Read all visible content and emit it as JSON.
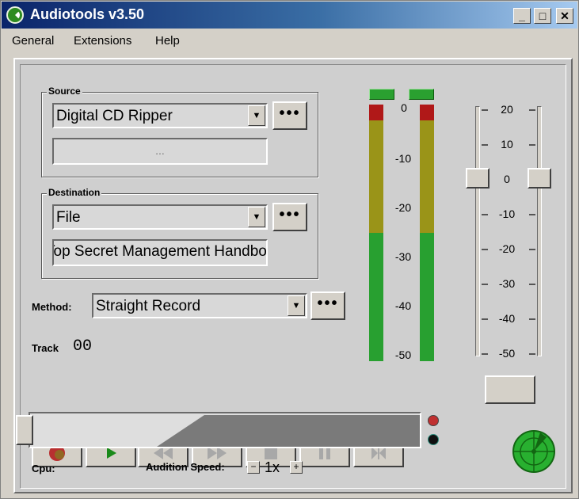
{
  "window": {
    "title": "Audiotools v3.50",
    "minimize": "_",
    "maximize": "□",
    "close": "✕"
  },
  "menu": {
    "general": "General",
    "extensions": "Extensions",
    "help": "Help"
  },
  "source": {
    "label": "Source",
    "selected": "Digital CD Ripper",
    "detail": "...",
    "dots": "•••"
  },
  "destination": {
    "label": "Destination",
    "selected": "File",
    "detail": "Top Secret Management Handbook",
    "dots": "•••"
  },
  "method": {
    "label": "Method:",
    "selected": "Straight Record",
    "dots": "•••"
  },
  "track": {
    "label": "Track",
    "value": "00"
  },
  "meter_scale": [
    "0",
    "-10",
    "-20",
    "-30",
    "-40",
    "-50"
  ],
  "volume_scale": [
    "20",
    "10",
    "0",
    "-10",
    "-20",
    "-30",
    "-40",
    "-50"
  ],
  "volume": {
    "left_db": 0,
    "right_db": 0
  },
  "transport": [
    "record",
    "play",
    "rewind",
    "fast-forward",
    "stop",
    "pause",
    "skip"
  ],
  "colors": {
    "record": "#b83030",
    "play": "#1a8a1a",
    "title_start": "#0a246a"
  },
  "bottom": {
    "cpu_label": "Cpu:",
    "audition_label": "Audition Speed:",
    "speed_value": "1x",
    "speed_minus": "−",
    "speed_plus": "+"
  }
}
